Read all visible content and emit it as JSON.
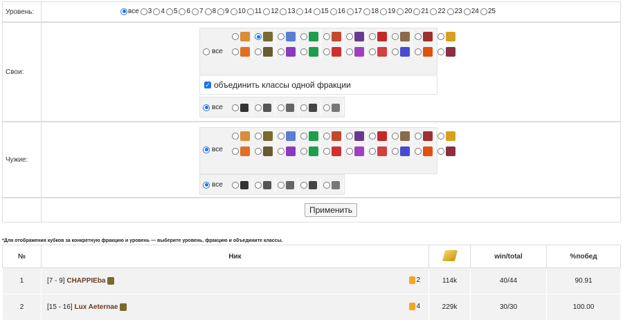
{
  "level": {
    "label": "Уровень:",
    "all": "все",
    "options": [
      "3",
      "4",
      "5",
      "6",
      "7",
      "8",
      "9",
      "10",
      "11",
      "12",
      "13",
      "14",
      "15",
      "16",
      "17",
      "18",
      "19",
      "20",
      "21",
      "22",
      "23",
      "24",
      "25"
    ]
  },
  "own": {
    "label": "Свои:",
    "all": "все",
    "merge_label": "объединить классы одной фракции",
    "faction_all": "все"
  },
  "foreign": {
    "label": "Чужие:",
    "all": "все",
    "faction_all": "все"
  },
  "apply_label": "Применить",
  "note": "*Для отображения кубков за конкретную фракцию и уровень — выберите уровень, фракцию и объедините классы.",
  "table": {
    "headers": {
      "num": "№",
      "nick": "Ник",
      "win": "win/total",
      "pct": "%побед"
    },
    "rows": [
      {
        "num": "1",
        "level": "[7 - 9]",
        "name": "CHAPPIEba",
        "cups": "2",
        "gold": "114k",
        "win": "40/44",
        "pct": "90.91"
      },
      {
        "num": "2",
        "level": "[15 - 16]",
        "name": "Lux Aeternae",
        "cups": "4",
        "gold": "229k",
        "win": "30/30",
        "pct": "100.00"
      }
    ]
  },
  "colors": {
    "accent": "#1a73e8",
    "nick": "#6b3a1f"
  }
}
